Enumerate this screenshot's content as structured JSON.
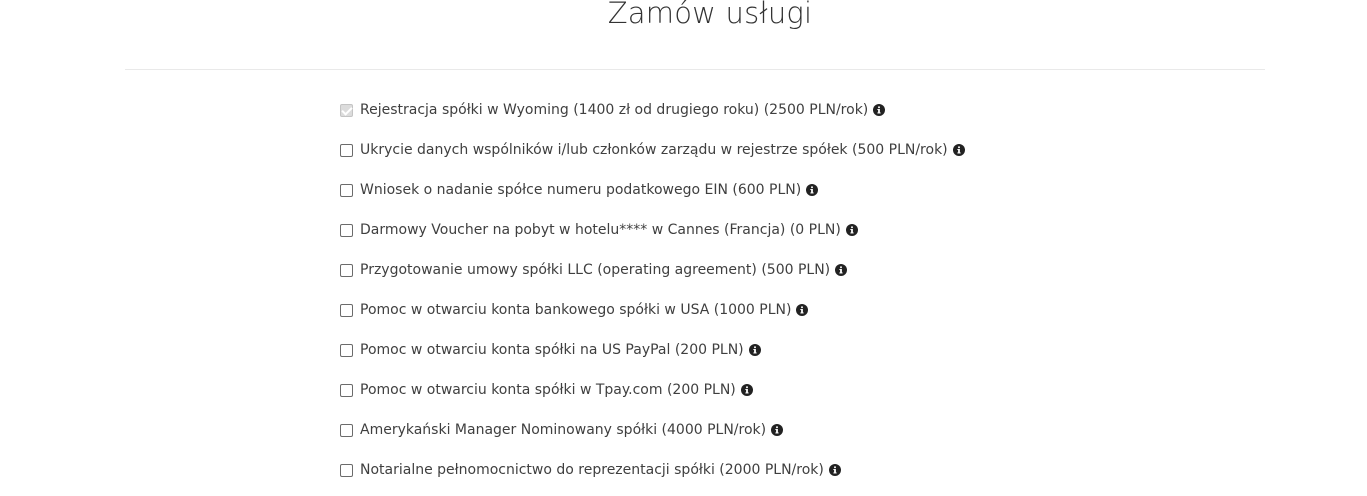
{
  "header": {
    "title": "Zamów usługi"
  },
  "services": [
    {
      "label": "Rejestracja spółki w Wyoming (1400 zł od drugiego roku) (2500 PLN/rok)",
      "checked": true,
      "disabled": true
    },
    {
      "label": "Ukrycie danych wspólników i/lub członków zarządu w rejestrze spółek (500 PLN/rok)",
      "checked": false,
      "disabled": false
    },
    {
      "label": "Wniosek o nadanie spółce numeru podatkowego EIN (600 PLN)",
      "checked": false,
      "disabled": false
    },
    {
      "label": "Darmowy Voucher na pobyt w hotelu**** w Cannes (Francja) (0 PLN)",
      "checked": false,
      "disabled": false
    },
    {
      "label": "Przygotowanie umowy spółki LLC (operating agreement) (500 PLN)",
      "checked": false,
      "disabled": false
    },
    {
      "label": "Pomoc w otwarciu konta bankowego spółki w USA (1000 PLN)",
      "checked": false,
      "disabled": false
    },
    {
      "label": "Pomoc w otwarciu konta spółki na US PayPal (200 PLN)",
      "checked": false,
      "disabled": false
    },
    {
      "label": "Pomoc w otwarciu konta spółki w Tpay.com (200 PLN)",
      "checked": false,
      "disabled": false
    },
    {
      "label": "Amerykański Manager Nominowany spółki (4000 PLN/rok)",
      "checked": false,
      "disabled": false
    },
    {
      "label": "Notarialne pełnomocnictwo do reprezentacji spółki (2000 PLN/rok)",
      "checked": false,
      "disabled": false
    }
  ],
  "icons": {
    "info": "info-icon"
  }
}
